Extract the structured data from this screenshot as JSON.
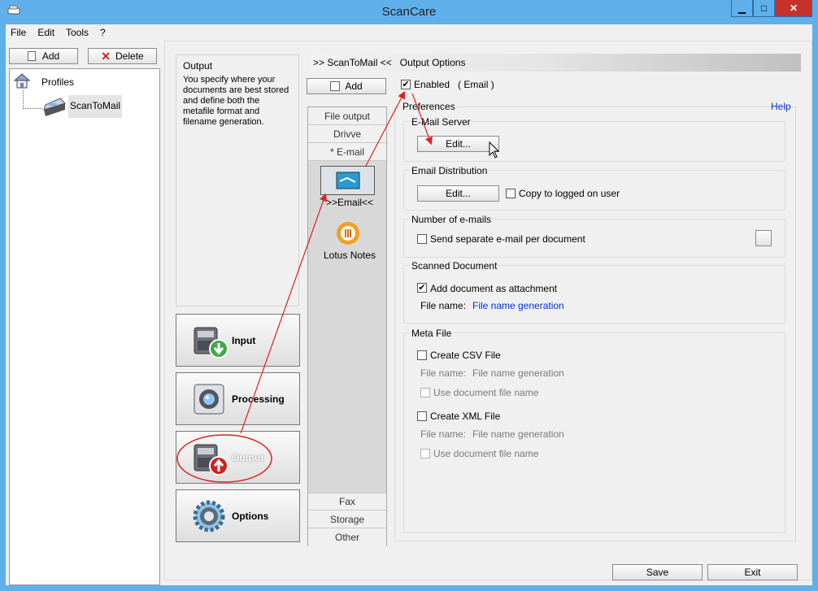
{
  "app": {
    "title": "ScanCare",
    "minimize": "▁",
    "maximize": "□",
    "close": "✕"
  },
  "menu": [
    "File",
    "Edit",
    "Tools",
    "?"
  ],
  "left_panel": {
    "add_label": "Add",
    "delete_label": "Delete",
    "tree": {
      "root": "Profiles",
      "child": "ScanToMail"
    }
  },
  "info": {
    "title": "Output",
    "text": "You specify where your documents are best stored and define both the metafile format and filename generation."
  },
  "nav": {
    "input": "Input",
    "processing": "Processing",
    "output": "Output",
    "options": "Options"
  },
  "plugin": {
    "add_label": "Add",
    "tabs_top": [
      "File output",
      "Drivve",
      "* E-mail"
    ],
    "selected_icon_label": ">>Email<<",
    "lotus_label": "Lotus Notes",
    "tabs_bottom": [
      "Fax",
      "Storage",
      "Other"
    ]
  },
  "header": {
    "breadcrumb": ">> ScanToMail <<   Output Options"
  },
  "options": {
    "enabled_label": "Enabled   ( Email )",
    "preferences": "Preferences",
    "help": "Help",
    "email_server": {
      "title": "E-Mail Server",
      "edit": "Edit..."
    },
    "email_distribution": {
      "title": "Email Distribution",
      "edit": "Edit...",
      "copy_label": "Copy to logged on user"
    },
    "number_of_emails": {
      "title": "Number of e-mails",
      "separate_label": "Send separate e-mail per document"
    },
    "scanned_document": {
      "title": "Scanned Document",
      "attach_label": "Add document as attachment",
      "file_name_label": "File name:",
      "file_name_link": "File name generation"
    },
    "meta_file": {
      "title": "Meta File",
      "csv_label": "Create CSV File",
      "csv_file_name_label": "File name:",
      "csv_file_name_value": "File name generation",
      "csv_use_doc": "Use document file name",
      "xml_label": "Create XML File",
      "xml_file_name_label": "File name:",
      "xml_file_name_value": "File name generation",
      "xml_use_doc": "Use document file name"
    }
  },
  "footer": {
    "save": "Save",
    "exit": "Exit"
  },
  "colors": {
    "title_bar": "#5fb0ea",
    "close_button": "#c7312b",
    "link": "#0033cc",
    "annotation": "#e02020"
  }
}
